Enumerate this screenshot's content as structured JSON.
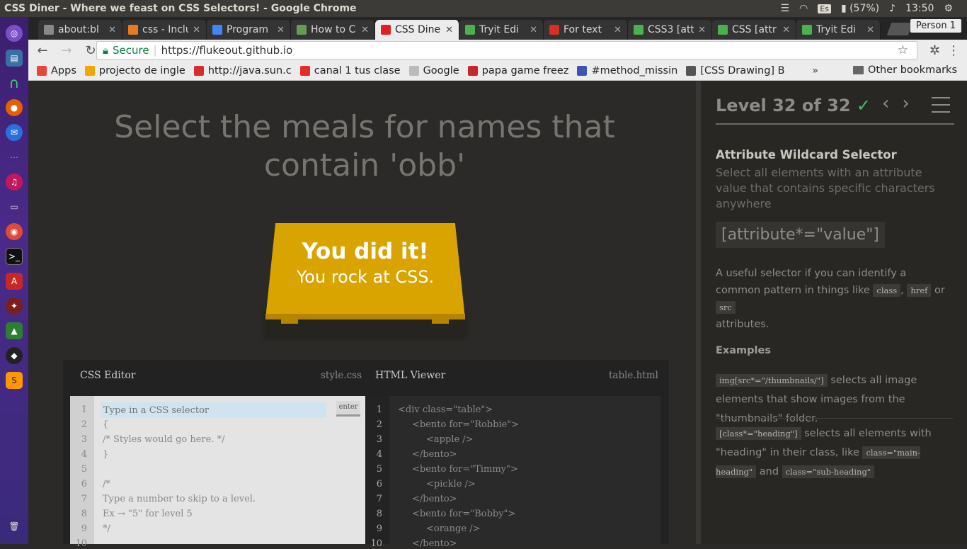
{
  "system": {
    "window_title": "CSS Diner - Where we feast on CSS Selectors! - Google Chrome",
    "keyboard": "Es",
    "battery": "(57%)",
    "time": "13:50"
  },
  "browser": {
    "tabs": [
      {
        "label": "about:bl",
        "color": "#888888"
      },
      {
        "label": "css - Inclu",
        "color": "#e87a22"
      },
      {
        "label": "Program",
        "color": "#4285f4"
      },
      {
        "label": "How to C",
        "color": "#6a9955"
      },
      {
        "label": "CSS Dine",
        "color": "#e02020",
        "active": true
      },
      {
        "label": "Tryit Edi",
        "color": "#4caf50"
      },
      {
        "label": "For text",
        "color": "#d93025"
      },
      {
        "label": "CSS3 [att",
        "color": "#4caf50"
      },
      {
        "label": "CSS [attr",
        "color": "#4caf50"
      },
      {
        "label": "Tryit Edi",
        "color": "#4caf50"
      }
    ],
    "person": "Person 1",
    "secure_label": "Secure",
    "url": "https://flukeout.github.io",
    "bookmarks": [
      {
        "label": "Apps",
        "color": "#e8453c"
      },
      {
        "label": "projecto de ingle",
        "color": "#f2a600"
      },
      {
        "label": "http://java.sun.c",
        "color": "#d32f2f"
      },
      {
        "label": "canal 1 tus clase",
        "color": "#e52d27"
      },
      {
        "label": "Google",
        "color": "#bbbbbb"
      },
      {
        "label": "papa game freez",
        "color": "#c62828"
      },
      {
        "label": "#method_missin",
        "color": "#3f51b5"
      },
      {
        "label": "[CSS Drawing] B",
        "color": "#555555"
      }
    ],
    "bookmarks_more": "»",
    "other_bookmarks": "Other bookmarks"
  },
  "game": {
    "instruction": "Select the meals for names that contain 'obb'",
    "win_title": "You did it!",
    "win_sub": "You rock at CSS.",
    "css_editor_title": "CSS Editor",
    "css_file": "style.css",
    "html_viewer_title": "HTML Viewer",
    "html_file": "table.html",
    "input_placeholder": "Type in a CSS selector",
    "enter_label": "enter",
    "css_lines": [
      "{",
      "/* Styles would go here. */",
      "}",
      "",
      "/*",
      "Type a number to skip to a level.",
      "Ex → \"5\" for level 5",
      "*/"
    ],
    "line_numbers": [
      "1",
      "2",
      "3",
      "4",
      "5",
      "6",
      "7",
      "8",
      "9",
      "10"
    ],
    "html_lines": [
      "<div class=\"table\">",
      "<bento for=\"Robbie\">",
      "<apple />",
      "</bento>",
      "<bento for=\"Timmy\">",
      "<pickle />",
      "</bento>",
      "<bento for=\"Bobby\">",
      "<orange />",
      "</bento>"
    ]
  },
  "sidebar": {
    "level_text": "Level 32 of 32",
    "check": "✓",
    "selector_title": "Attribute Wildcard Selector",
    "selector_desc": "Select all elements with an attribute value that contains specific characters anywhere",
    "syntax": "[attribute*=\"value\"]",
    "help_1": "A useful selector if you can identify a common pattern in things like",
    "help_code_1": "class",
    "help_sep": ",",
    "help_code_2": "href",
    "help_or": "or",
    "help_code_3": "src",
    "help_2": "attributes.",
    "examples_title": "Examples",
    "ex1_code": "img[src*=\"/thumbnails/\"]",
    "ex1_text": "selects all image elements that show images from the \"thumbnails\" folder.",
    "ex2_code": "[class*=\"heading\"]",
    "ex2_text": "selects all elements with \"heading\" in their class, like",
    "ex2_code_b": "class=\"main-heading\"",
    "ex2_and": "and",
    "ex2_code_c": "class=\"sub-heading\""
  }
}
